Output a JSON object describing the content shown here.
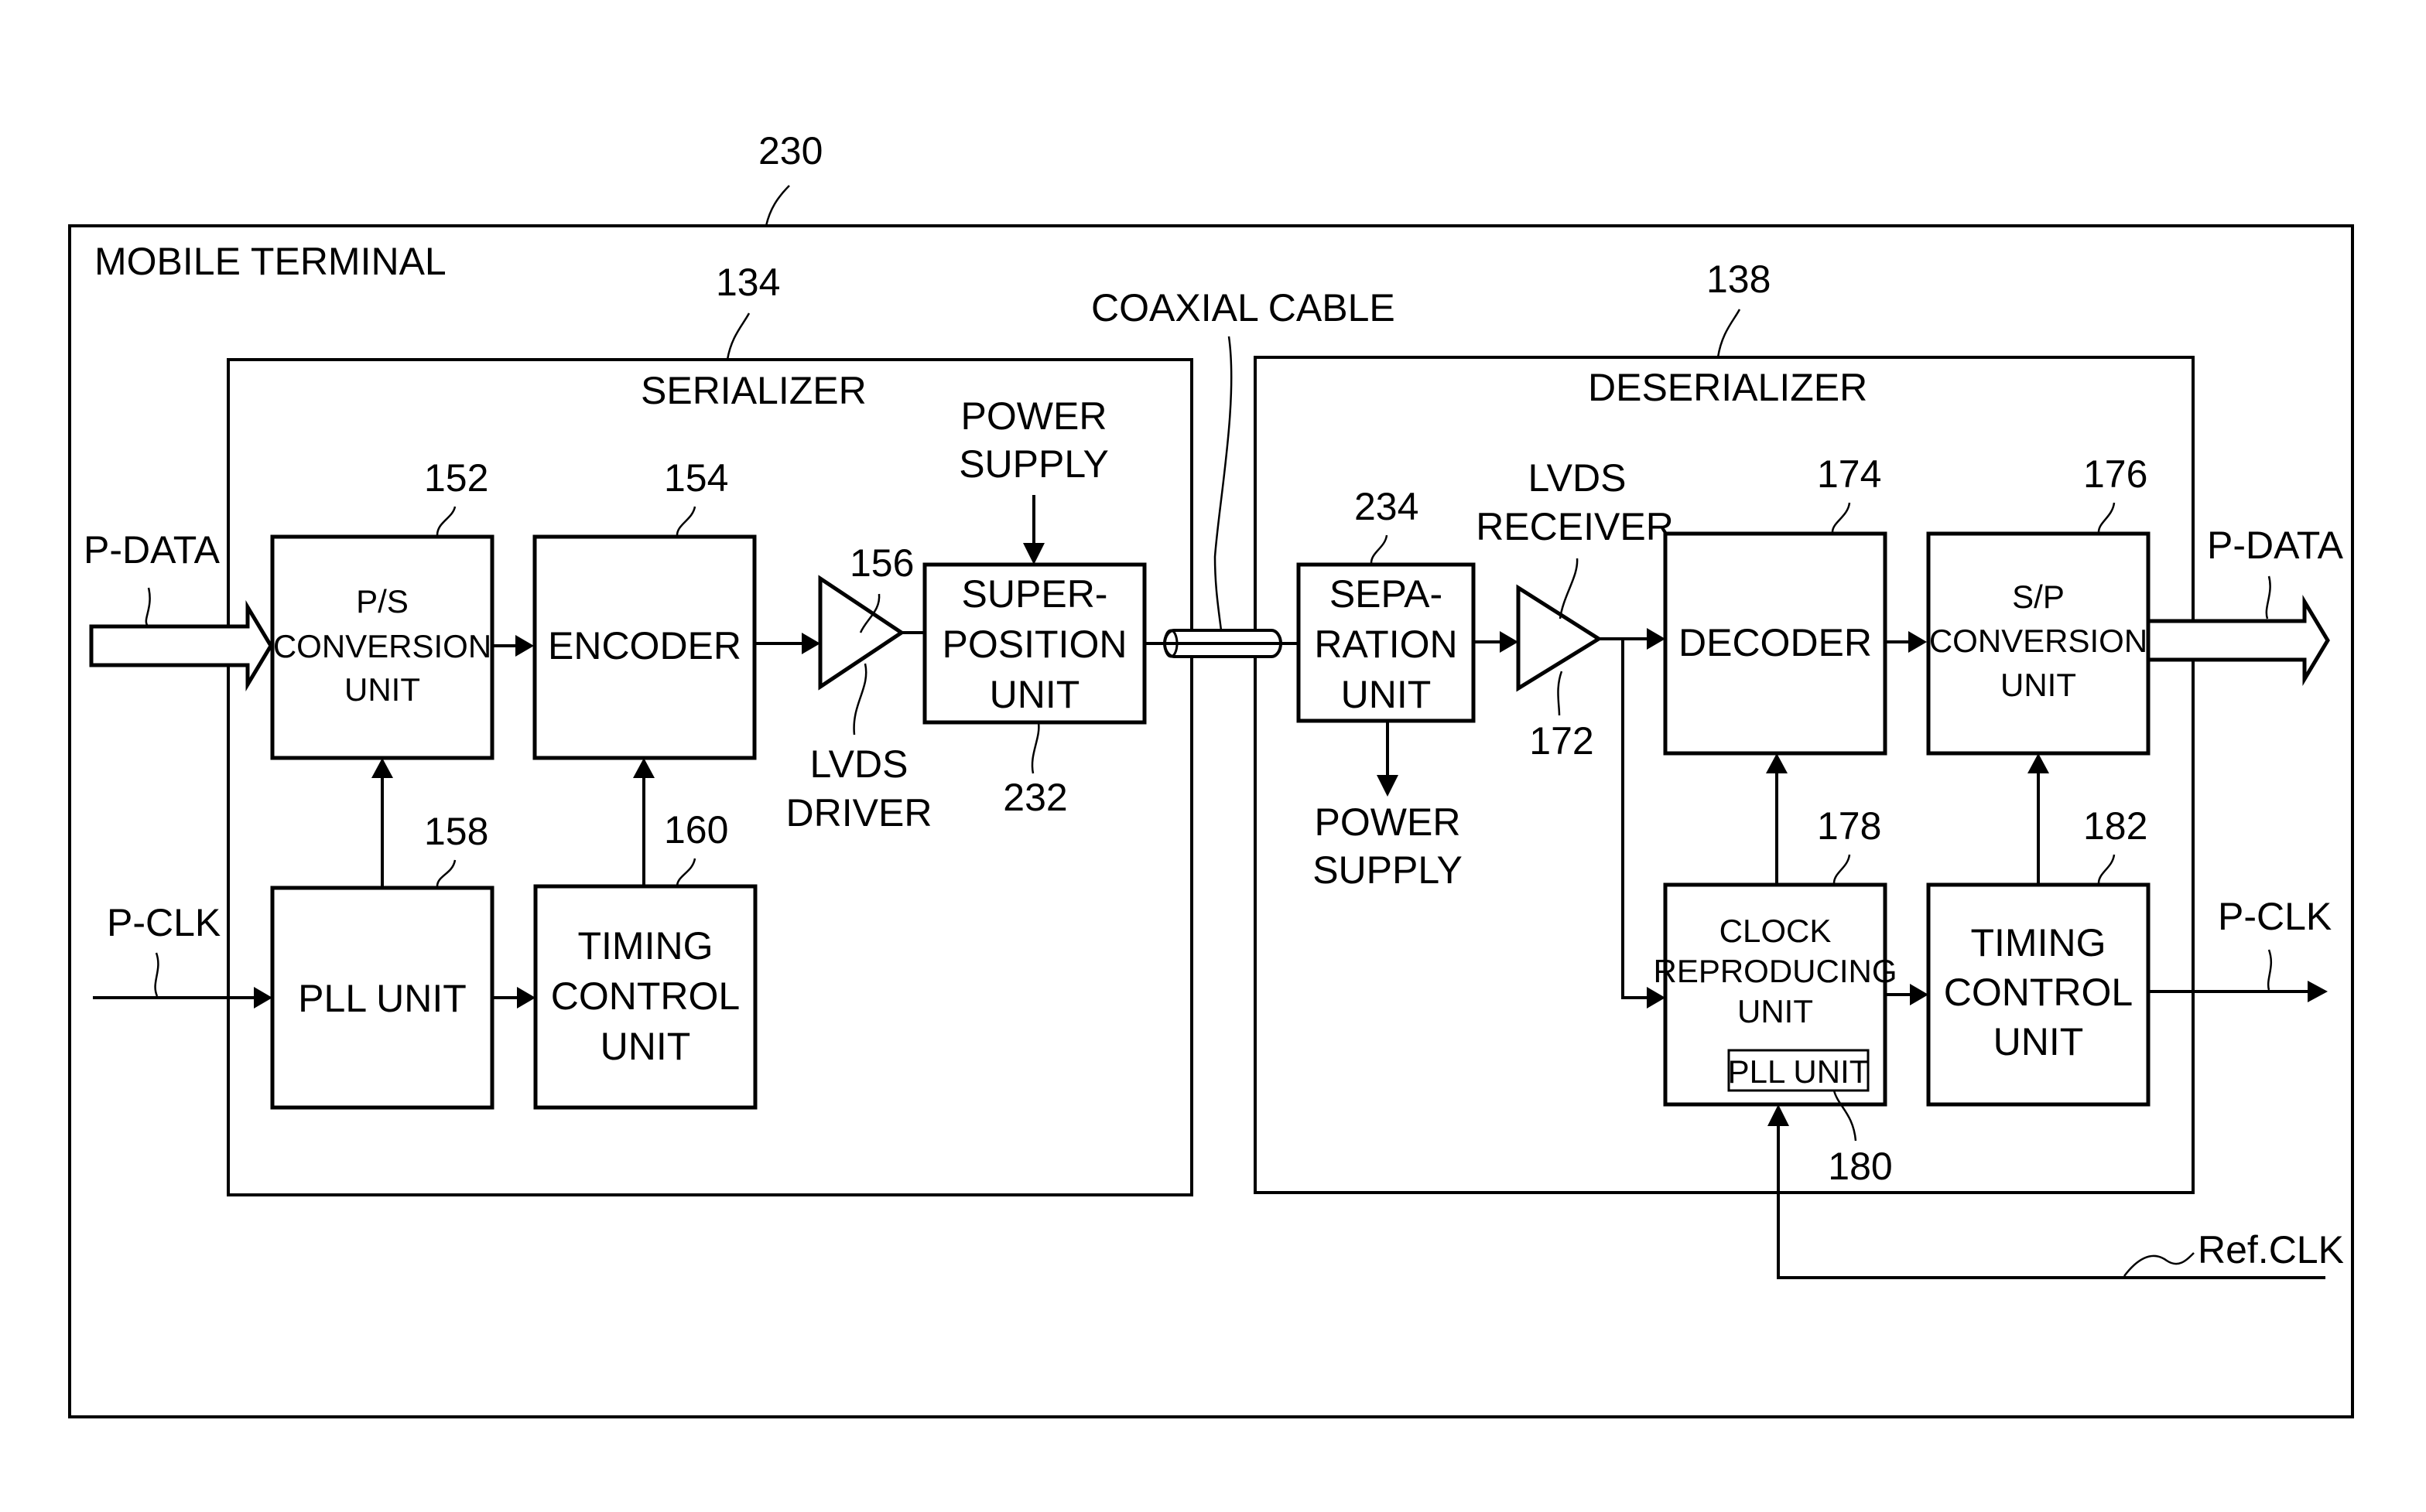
{
  "figure": {
    "ref_terminal": "230",
    "terminal_label": "MOBILE TERMINAL",
    "coaxial_cable": "COAXIAL CABLE"
  },
  "serializer": {
    "ref": "134",
    "title": "SERIALIZER",
    "input_data": "P-DATA",
    "input_clk": "P-CLK",
    "ps_unit": {
      "ref": "152",
      "lines": [
        "P/S",
        "CONVERSION",
        "UNIT"
      ]
    },
    "encoder": {
      "ref": "154",
      "label": "ENCODER"
    },
    "lvds_driver": {
      "ref": "156",
      "lines": [
        "LVDS",
        "DRIVER"
      ]
    },
    "power_supply": {
      "lines": [
        "POWER",
        "SUPPLY"
      ]
    },
    "superposition_unit": {
      "ref": "232",
      "lines": [
        "SUPER-",
        "POSITION",
        "UNIT"
      ]
    },
    "pll_unit": {
      "ref": "158",
      "label": "PLL UNIT"
    },
    "timing_control": {
      "ref": "160",
      "lines": [
        "TIMING",
        "CONTROL",
        "UNIT"
      ]
    }
  },
  "deserializer": {
    "ref": "138",
    "title": "DESERIALIZER",
    "separation_unit": {
      "ref": "234",
      "lines": [
        "SEPA-",
        "RATION",
        "UNIT"
      ]
    },
    "power_supply": {
      "lines": [
        "POWER",
        "SUPPLY"
      ]
    },
    "lvds_receiver": {
      "ref": "172",
      "lines": [
        "LVDS",
        "RECEIVER"
      ]
    },
    "decoder": {
      "ref": "174",
      "label": "DECODER"
    },
    "sp_unit": {
      "ref": "176",
      "lines": [
        "S/P",
        "CONVERSION",
        "UNIT"
      ]
    },
    "clock_reproducing": {
      "ref": "178",
      "lines": [
        "CLOCK",
        "REPRODUCING",
        "UNIT"
      ]
    },
    "inner_pll": {
      "ref": "180",
      "label": "PLL UNIT"
    },
    "timing_control": {
      "ref": "182",
      "lines": [
        "TIMING",
        "CONTROL",
        "UNIT"
      ]
    },
    "output_data": "P-DATA",
    "output_clk": "P-CLK",
    "ref_clk": "Ref.CLK"
  }
}
